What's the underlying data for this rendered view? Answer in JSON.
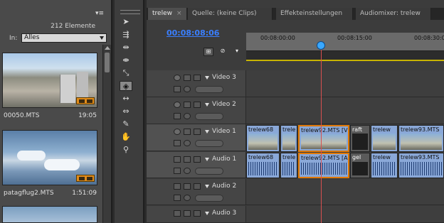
{
  "project": {
    "menu_icon": "panel-menu-icon",
    "count": "212 Elemente",
    "filter_label": "In:",
    "filter_value": "Alles",
    "clips": [
      {
        "name": "00050.MTS",
        "duration": "19:05"
      },
      {
        "name": "patagflug2.MTS",
        "duration": "1:51:09"
      }
    ]
  },
  "timeline": {
    "tabs": [
      {
        "label": "trelew",
        "close": "×"
      },
      {
        "label": "Quelle: (keine Clips)"
      },
      {
        "label": "Effekteinstellungen"
      },
      {
        "label": "Audiomixer: trelew"
      }
    ],
    "timecode": "00:08:08:06",
    "ruler_labels": [
      "00:08:00:00",
      "00:08:15:00",
      "00:08:30:00"
    ],
    "tracks": [
      {
        "label": "Video 3"
      },
      {
        "label": "Video 2"
      },
      {
        "label": "Video 1"
      },
      {
        "label": "Audio 1"
      },
      {
        "label": "Audio 2"
      },
      {
        "label": "Audio 3"
      }
    ],
    "video1_clips": [
      "trelew68",
      "trele",
      "trelew92.MTS [V]",
      "raft",
      "trelew",
      "trelew93.MTS"
    ],
    "audio1_clips": [
      "trelew68",
      "trele",
      "trelew92.MTS [A]",
      "gel",
      "trelew",
      "trelew93.MTS"
    ]
  },
  "colors": {
    "timecode": "#3a7fff",
    "playhead": "#d85050",
    "selection": "#e07800",
    "badge": "#e08b1a"
  }
}
